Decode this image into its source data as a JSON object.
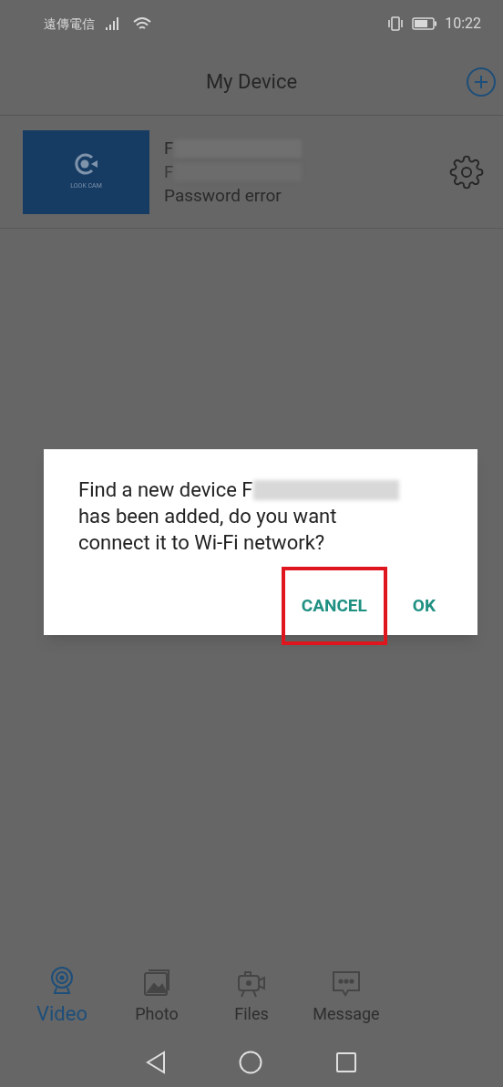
{
  "status_bar": {
    "carrier": "遠傳電信",
    "time": "10:22"
  },
  "header": {
    "title": "My Device"
  },
  "devices": [
    {
      "thumbnail_label": "LOOK CAM",
      "name": "F",
      "id": "F",
      "status": "Password error"
    }
  ],
  "tabs": [
    {
      "label": "Video",
      "selected": true,
      "kind": "webcam"
    },
    {
      "label": "Photo",
      "selected": false,
      "kind": "photo"
    },
    {
      "label": "Files",
      "selected": false,
      "kind": "camera"
    },
    {
      "label": "Message",
      "selected": false,
      "kind": "message"
    }
  ],
  "dialog": {
    "message_start": "Find a new device F",
    "message_end": "has been added, do you want connect it to Wi-Fi network?",
    "buttons": [
      {
        "label": "CANCEL",
        "highlighted": true
      },
      {
        "label": "OK",
        "highlighted": false
      }
    ]
  }
}
